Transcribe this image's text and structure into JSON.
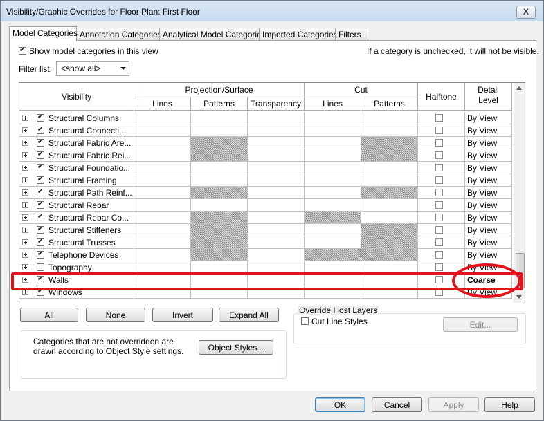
{
  "window": {
    "title": "Visibility/Graphic Overrides for Floor Plan: First Floor",
    "close_glyph": "X"
  },
  "tabs": [
    {
      "label": "Model Categories",
      "active": true
    },
    {
      "label": "Annotation Categories",
      "active": false
    },
    {
      "label": "Analytical Model Categories",
      "active": false
    },
    {
      "label": "Imported Categories",
      "active": false
    },
    {
      "label": "Filters",
      "active": false
    }
  ],
  "options": {
    "show_model_categories_label": "Show model categories in this view",
    "show_model_categories_checked": true,
    "hint": "If a category is unchecked, it will not be visible.",
    "filter_label": "Filter list:",
    "filter_value": "<show all>"
  },
  "grid": {
    "headers": {
      "visibility": "Visibility",
      "projection_surface": "Projection/Surface",
      "cut": "Cut",
      "halftone": "Halftone",
      "detail_level": "Detail Level",
      "lines": "Lines",
      "patterns": "Patterns",
      "transparency": "Transparency",
      "cut_lines": "Lines",
      "cut_patterns": "Patterns"
    },
    "rows": [
      {
        "name": "Structural Columns",
        "checked": true,
        "detail": "By View"
      },
      {
        "name": "Structural Connecti...",
        "checked": true,
        "detail": "By View"
      },
      {
        "name": "Structural Fabric Are...",
        "checked": true,
        "detail": "By View"
      },
      {
        "name": "Structural Fabric Rei...",
        "checked": true,
        "detail": "By View"
      },
      {
        "name": "Structural Foundatio...",
        "checked": true,
        "detail": "By View"
      },
      {
        "name": "Structural Framing",
        "checked": true,
        "detail": "By View"
      },
      {
        "name": "Structural Path Reinf...",
        "checked": true,
        "detail": "By View"
      },
      {
        "name": "Structural Rebar",
        "checked": true,
        "detail": "By View"
      },
      {
        "name": "Structural Rebar Co...",
        "checked": true,
        "detail": "By View"
      },
      {
        "name": "Structural Stiffeners",
        "checked": true,
        "detail": "By View"
      },
      {
        "name": "Structural Trusses",
        "checked": true,
        "detail": "By View"
      },
      {
        "name": "Telephone Devices",
        "checked": true,
        "detail": "By View"
      },
      {
        "name": "Topography",
        "checked": false,
        "detail": "By View"
      },
      {
        "name": "Walls",
        "checked": true,
        "detail": "Coarse"
      },
      {
        "name": "Windows",
        "checked": true,
        "detail": "By View"
      }
    ]
  },
  "buttons": {
    "all": "All",
    "none": "None",
    "invert": "Invert",
    "expand_all": "Expand All",
    "object_styles": "Object Styles...",
    "edit": "Edit...",
    "ok": "OK",
    "cancel": "Cancel",
    "apply": "Apply",
    "help": "Help"
  },
  "override_host": {
    "title": "Override Host Layers",
    "cut_line_styles": "Cut Line Styles",
    "cut_line_styles_checked": false
  },
  "note": "Categories that are not overridden are drawn according to Object Style settings.",
  "colors": {
    "highlight": "#e3131b",
    "titlebar": "#c6d9ee"
  }
}
